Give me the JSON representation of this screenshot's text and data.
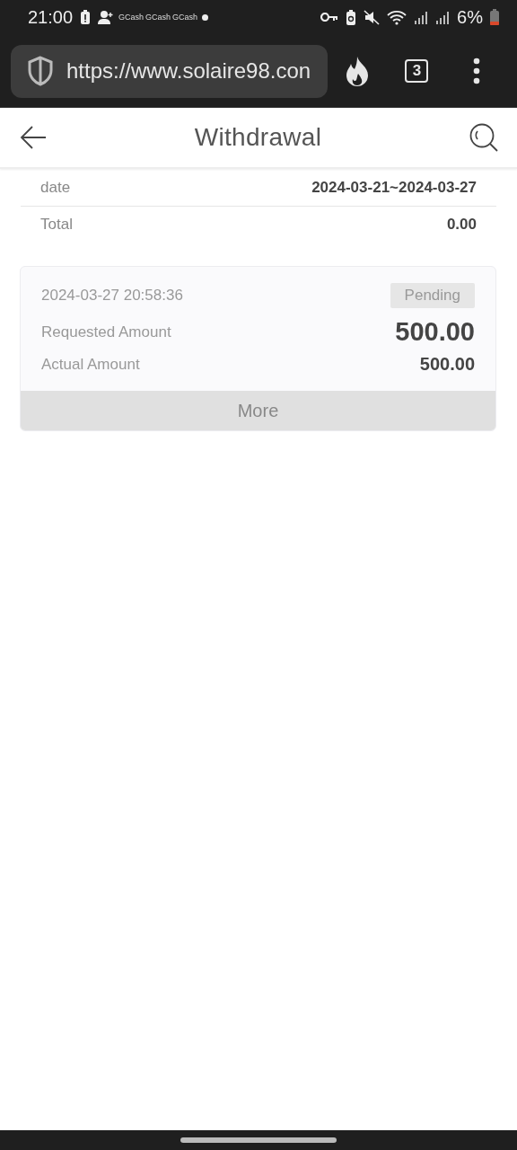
{
  "status_bar": {
    "time": "21:00",
    "notification_labels": [
      "GCash",
      "GCash",
      "GCash"
    ],
    "battery": "6%"
  },
  "browser": {
    "url": "https://www.solaire98.con",
    "tab_count": "3"
  },
  "header": {
    "title": "Withdrawal"
  },
  "summary": [
    {
      "label": "date",
      "value": "2024-03-21~2024-03-27"
    },
    {
      "label": "Total",
      "value": "0.00"
    }
  ],
  "records": [
    {
      "datetime": "2024-03-27 20:58:36",
      "status": "Pending",
      "requested_label": "Requested Amount",
      "requested_amount": "500.00",
      "actual_label": "Actual Amount",
      "actual_amount": "500.00",
      "more": "More"
    }
  ]
}
